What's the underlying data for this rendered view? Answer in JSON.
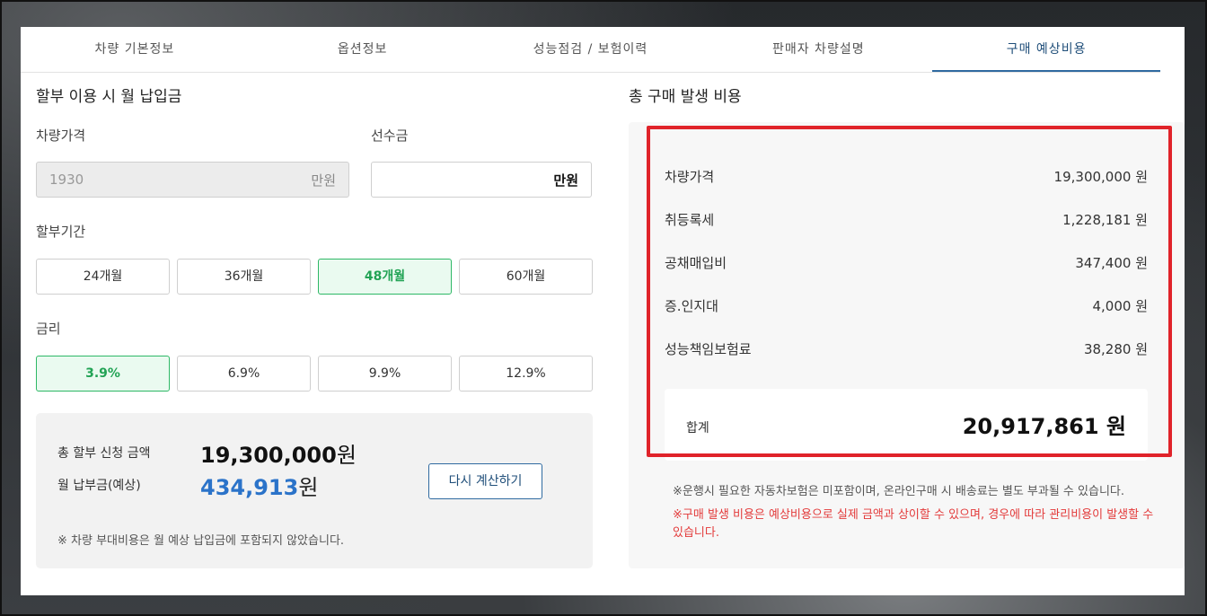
{
  "tabs": [
    {
      "label": "차량 기본정보"
    },
    {
      "label": "옵션정보"
    },
    {
      "label": "성능점검 / 보험이력"
    },
    {
      "label": "판매자 차량설명"
    },
    {
      "label": "구매 예상비용"
    }
  ],
  "left": {
    "title": "할부 이용 시 월 납입금",
    "price_label": "차량가격",
    "price_value": "1930",
    "price_unit": "만원",
    "down_label": "선수금",
    "down_value": "",
    "down_unit": "만원",
    "period_label": "할부기간",
    "periods": [
      "24개월",
      "36개월",
      "48개월",
      "60개월"
    ],
    "rate_label": "금리",
    "rates": [
      "3.9%",
      "6.9%",
      "9.9%",
      "12.9%"
    ],
    "summary": {
      "total_label": "총 할부 신청 금액",
      "total_value": "19,300,000",
      "total_unit": "원",
      "monthly_label": "월 납부금(예상)",
      "monthly_value": "434,913",
      "monthly_unit": "원",
      "recalc_label": "다시 계산하기",
      "note": "※ 차량 부대비용은 월 예상 납입금에 포함되지 않았습니다."
    }
  },
  "right": {
    "title": "총 구매 발생 비용",
    "rows": [
      {
        "label": "차량가격",
        "value": "19,300,000 원"
      },
      {
        "label": "취등록세",
        "value": "1,228,181 원"
      },
      {
        "label": "공채매입비",
        "value": "347,400 원"
      },
      {
        "label": "증.인지대",
        "value": "4,000 원"
      },
      {
        "label": "성능책임보험료",
        "value": "38,280 원"
      }
    ],
    "total_label": "합계",
    "total_value": "20,917,861 원",
    "note1": "※운행시 필요한 자동차보험은 미포함이며, 온라인구매 시 배송료는 별도 부과될 수 있습니다.",
    "note2": "※구매 발생 비용은 예상비용으로 실제 금액과 상이할 수 있으며, 경우에 따라 관리비용이 발생할 수 있습니다."
  }
}
